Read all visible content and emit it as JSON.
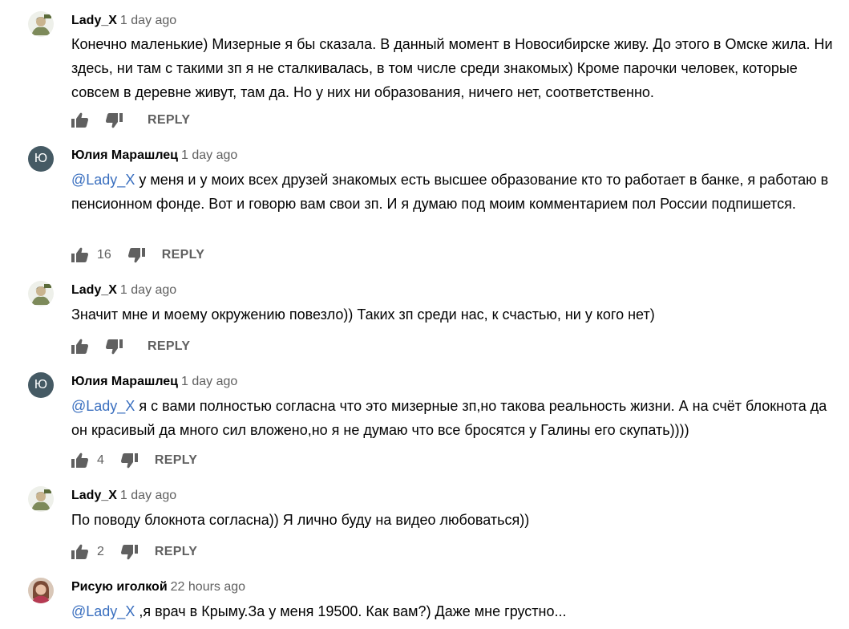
{
  "colors": {
    "mention": "#3a6fbf",
    "avatar_letter_bg": "#455a64",
    "secondary_text": "#606060"
  },
  "comments": [
    {
      "author": "Lady_X",
      "time": "1 day ago",
      "avatar": "lady-x-avatar-image",
      "mention": "",
      "text": "Конечно маленькие) Мизерные я бы сказала. В данный момент в Новосибирске живу. До этого в Омске жила. Ни здесь, ни там с такими зп я не сталкивалась,  в том числе среди знакомых) Кроме парочки человек, которые совсем в деревне живут, там да. Но у них ни образования, ничего нет, соответственно.",
      "likes": "",
      "reply_label": "REPLY"
    },
    {
      "author": "Юлия Марашлец",
      "time": "1 day ago",
      "avatar_letter": "Ю",
      "mention": "@Lady_X",
      "text": " у меня и у моих всех друзей знакомых есть высшее образование кто то работает в банке, я работаю в пенсионном фонде. Вот и говорю вам свои зп. И я думаю под моим комментарием пол России подпишется.",
      "likes": "16",
      "reply_label": "REPLY"
    },
    {
      "author": "Lady_X",
      "time": "1 day ago",
      "avatar": "lady-x-avatar-image",
      "mention": "",
      "text": "Значит мне и моему окружению повезло)) Таких зп среди нас, к счастью, ни у кого нет)",
      "likes": "",
      "reply_label": "REPLY"
    },
    {
      "author": "Юлия Марашлец",
      "time": "1 day ago",
      "avatar_letter": "Ю",
      "mention": "@Lady_X",
      "text": " я с вами полностью согласна что это мизерные зп,но такова реальность жизни. А на счёт блокнота да он красивый да много сил вложено,но я не думаю что все бросятся у Галины его скупать))))",
      "likes": "4",
      "reply_label": "REPLY"
    },
    {
      "author": "Lady_X",
      "time": "1 day ago",
      "avatar": "lady-x-avatar-image",
      "mention": "",
      "text": "По поводу блокнота согласна)) Я лично буду на видео любоваться))",
      "likes": "2",
      "reply_label": "REPLY"
    },
    {
      "author": "Рисую иголкой",
      "time": "22 hours ago",
      "avatar": "woman-avatar-image",
      "mention": "@Lady_X",
      "text": " ,я врач в Крыму.За у меня 19500. Как вам?) Даже мне грустно...",
      "likes": "",
      "reply_label": ""
    }
  ]
}
